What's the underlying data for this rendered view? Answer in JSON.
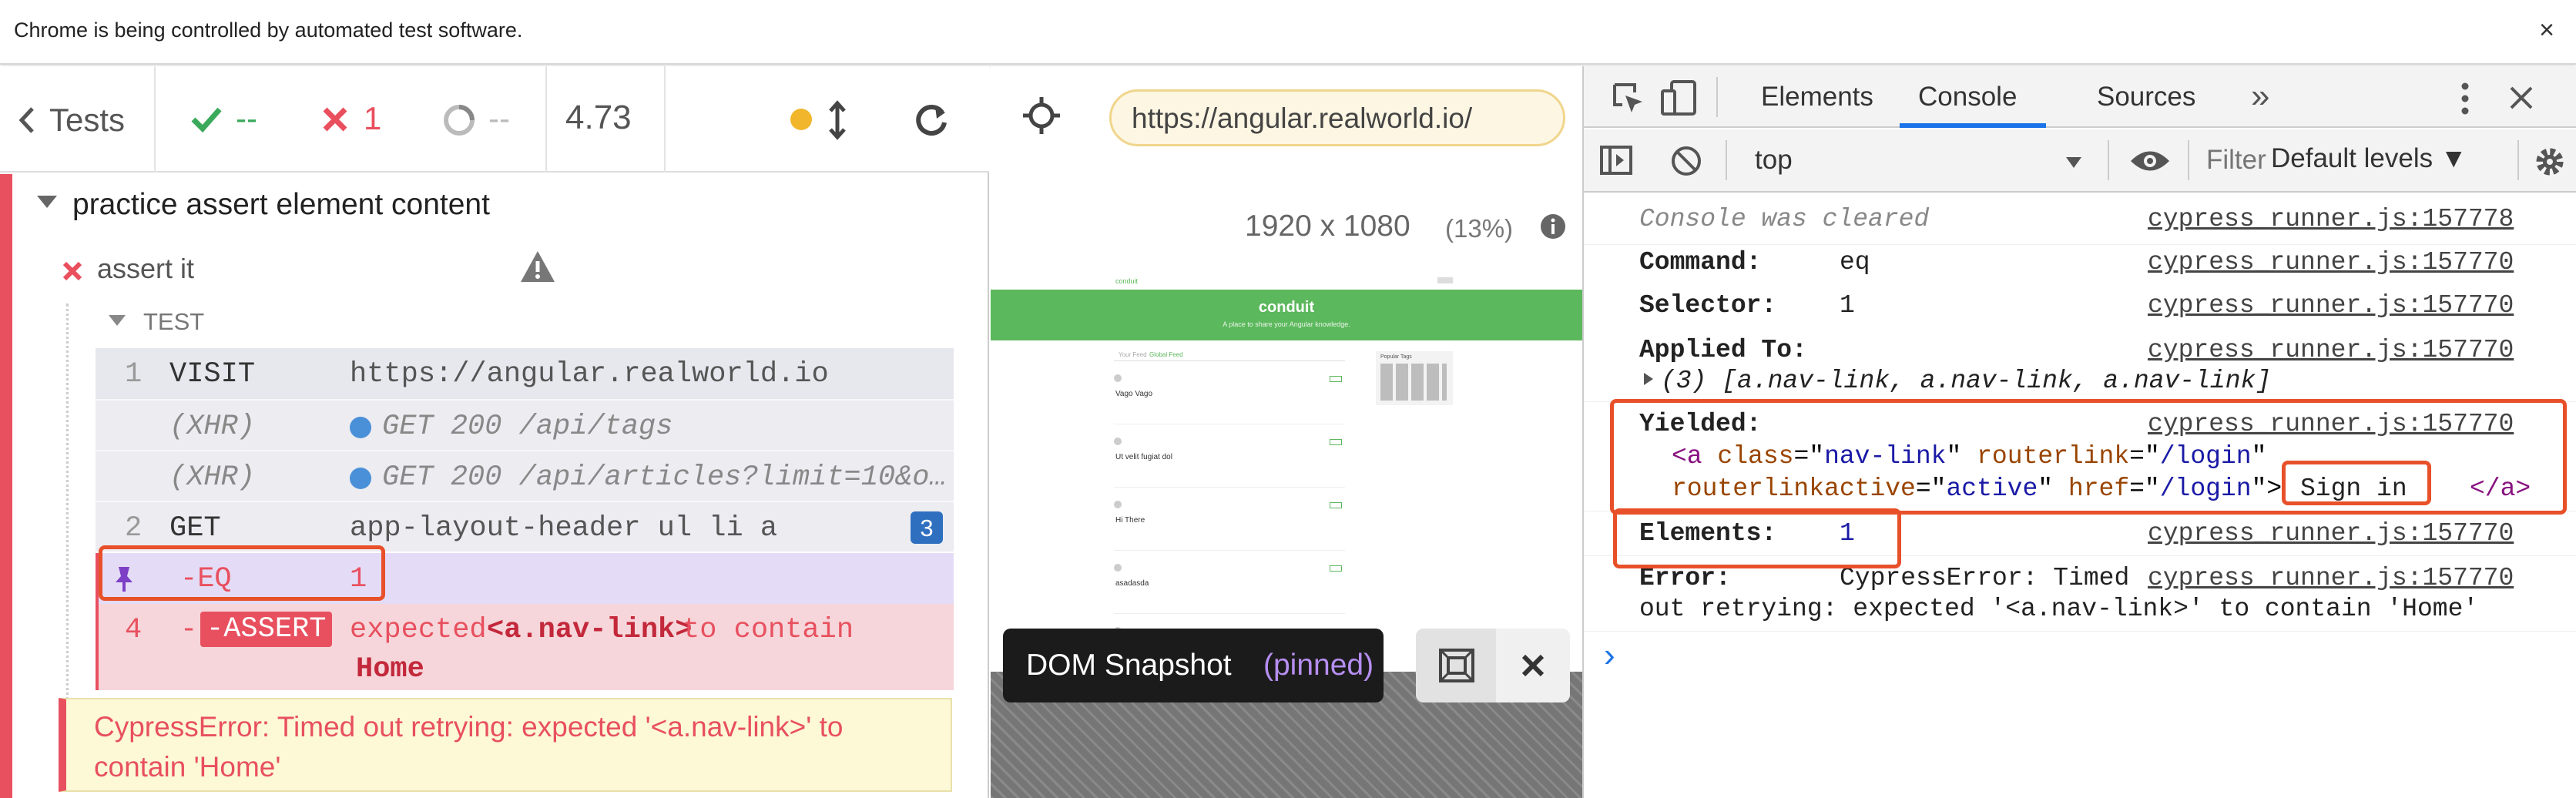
{
  "banner": {
    "text": "Chrome is being controlled by automated test software.",
    "close": "×"
  },
  "runner": {
    "header": {
      "tests_label": "Tests",
      "passed": "--",
      "failed": "1",
      "pending": "--",
      "duration": "4.73"
    },
    "suite_title": "practice assert element content",
    "test_title": "assert it",
    "section_label": "TEST",
    "commands": [
      {
        "num": "1",
        "name": "VISIT",
        "message": "https://angular.realworld.io"
      },
      {
        "num": "",
        "name": "(XHR)",
        "message": "GET 200 /api/tags"
      },
      {
        "num": "",
        "name": "(XHR)",
        "message": "GET 200 /api/articles?limit=10&o…"
      },
      {
        "num": "2",
        "name": "GET",
        "message": "app-layout-header ul li a",
        "badge": "3"
      },
      {
        "num": "",
        "name": "-EQ",
        "message": "1"
      },
      {
        "num": "4",
        "name": "-ASSERT",
        "message_parts": [
          "expected",
          "<a.nav-link>",
          "to contain",
          "Home"
        ]
      }
    ],
    "error": "CypressError: Timed out retrying: expected '<a.nav-link>' to contain 'Home'"
  },
  "aut": {
    "url": "https://angular.realworld.io/",
    "viewport": "1920 x 1080",
    "scale": "(13%)",
    "preview": {
      "brand": "conduit",
      "hero_title": "conduit",
      "hero_sub": "A place to share your Angular knowledge.",
      "tab1": "Your Feed",
      "tab2": "Global Feed",
      "tags_title": "Popular Tags",
      "articles": [
        "Vago Vago",
        "Ut velit fugiat dol",
        "Hi There",
        "asadasda"
      ]
    },
    "snapshot_label": "DOM Snapshot",
    "snapshot_state": "(pinned)"
  },
  "devtools": {
    "tabs": [
      "Elements",
      "Console",
      "Sources"
    ],
    "more": "»",
    "context": "top",
    "filter_placeholder": "Filter",
    "levels": "Default levels ▼",
    "log": {
      "cleared": "Console was cleared",
      "cleared_src": "cypress_runner.js:157778",
      "src": "cypress_runner.js:157770",
      "command_label": "Command:",
      "command_value": "eq",
      "selector_label": "Selector:",
      "selector_value": "1",
      "applied_label": "Applied To:",
      "applied_value": "(3) [a.nav-link, a.nav-link, a.nav-link]",
      "yielded_label": "Yielded:",
      "y_tag_open": "<a",
      "y_class_attr": "class",
      "y_class_val": "nav-link",
      "y_rl_attr": "routerlink",
      "y_rl_val": "/login",
      "y_rla_attr": "routerlinkactive",
      "y_rla_val": "active",
      "y_href_attr": "href",
      "y_href_val": "/login",
      "y_text": "Sign in",
      "y_close": "</a>",
      "elements_label": "Elements:",
      "elements_value": "1",
      "error_label": "Error:",
      "error_line1": "CypressError: Timed",
      "error_line2": "out retrying: expected '<a.nav-link>' to contain 'Home'",
      "prompt": "›"
    }
  }
}
